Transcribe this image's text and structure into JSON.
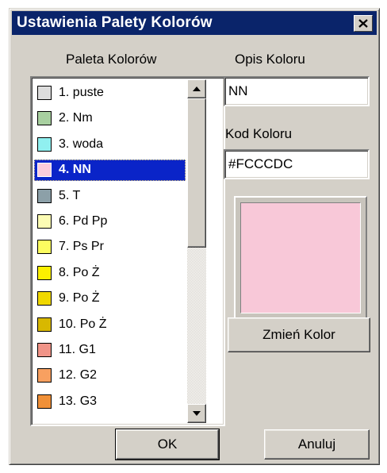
{
  "window": {
    "title": "Ustawienia Palety Kolorów",
    "close_icon": "close-icon"
  },
  "palette": {
    "heading": "Paleta Kolorów",
    "selected_index": 3,
    "items": [
      {
        "label": "1. puste",
        "color": "#DCDCDC"
      },
      {
        "label": "2. Nm",
        "color": "#A8D0A0"
      },
      {
        "label": "3. woda",
        "color": "#90F0F0"
      },
      {
        "label": "4. NN",
        "color": "#FCCCDC"
      },
      {
        "label": "5. T",
        "color": "#8CA0A8"
      },
      {
        "label": "6. Pd Pp",
        "color": "#FCFCB4"
      },
      {
        "label": "7. Ps Pr",
        "color": "#FCFC60"
      },
      {
        "label": "8. Po Ż",
        "color": "#FCF000"
      },
      {
        "label": "9. Po Ż",
        "color": "#F0D800"
      },
      {
        "label": "10. Po Ż",
        "color": "#D8B800"
      },
      {
        "label": "11. G1",
        "color": "#F09488"
      },
      {
        "label": "12. G2",
        "color": "#F8A060"
      },
      {
        "label": "13. G3",
        "color": "#F09038"
      }
    ],
    "scroll_up_icon": "scroll-up-arrow-icon",
    "scroll_down_icon": "scroll-down-arrow-icon"
  },
  "description": {
    "label": "Opis Koloru",
    "value": "NN"
  },
  "color_code": {
    "label": "Kod Koloru",
    "value": "#FCCCDC"
  },
  "preview": {
    "color": "#F8C8D8"
  },
  "buttons": {
    "change_color": "Zmień Kolor",
    "ok": "OK",
    "cancel": "Anuluj"
  },
  "colors": {
    "titlebar": "#0A246A",
    "selection": "#0A24C8",
    "face": "#D4D0C8"
  }
}
